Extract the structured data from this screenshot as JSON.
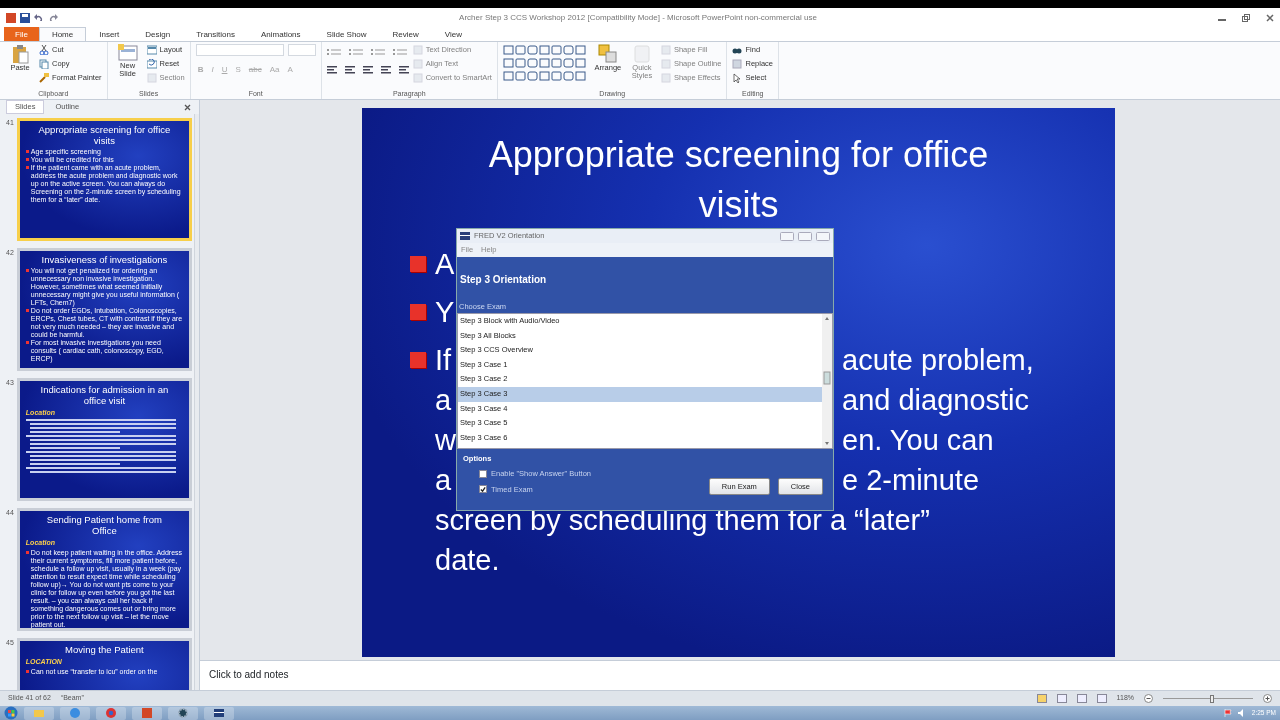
{
  "window": {
    "title": "Archer Step 3 CCS Workshop 2012 [Compatibility Mode] - Microsoft PowerPoint non-commercial use"
  },
  "ribbon_tabs": [
    {
      "label": "File",
      "kind": "file",
      "selected": false
    },
    {
      "label": "Home",
      "kind": "tab",
      "selected": true
    },
    {
      "label": "Insert",
      "kind": "tab",
      "selected": false
    },
    {
      "label": "Design",
      "kind": "tab",
      "selected": false
    },
    {
      "label": "Transitions",
      "kind": "tab",
      "selected": false
    },
    {
      "label": "Animations",
      "kind": "tab",
      "selected": false
    },
    {
      "label": "Slide Show",
      "kind": "tab",
      "selected": false
    },
    {
      "label": "Review",
      "kind": "tab",
      "selected": false
    },
    {
      "label": "View",
      "kind": "tab",
      "selected": false
    }
  ],
  "ribbon_groups": [
    {
      "label": "Clipboard",
      "items": [
        {
          "kind": "large",
          "label": "Paste",
          "disabled": false
        },
        {
          "kind": "small",
          "label": "Cut",
          "disabled": false
        },
        {
          "kind": "small",
          "label": "Copy",
          "disabled": false
        },
        {
          "kind": "small",
          "label": "Format Painter",
          "disabled": false
        }
      ]
    },
    {
      "label": "Slides",
      "items": [
        {
          "kind": "large",
          "label": "New Slide",
          "disabled": false
        },
        {
          "kind": "small",
          "label": "Layout",
          "disabled": false
        },
        {
          "kind": "small",
          "label": "Reset",
          "disabled": false
        },
        {
          "kind": "small",
          "label": "Section",
          "disabled": true
        }
      ]
    },
    {
      "label": "Font",
      "items": [
        {
          "kind": "font",
          "labels": [
            "B",
            "I",
            "U",
            "S",
            "abc",
            "Aa",
            "A"
          ],
          "disabled": true
        }
      ]
    },
    {
      "label": "Paragraph",
      "items": [
        {
          "kind": "para",
          "disabled": true
        },
        {
          "kind": "small",
          "label": "Text Direction",
          "disabled": true
        },
        {
          "kind": "small",
          "label": "Align Text",
          "disabled": true
        },
        {
          "kind": "small",
          "label": "Convert to SmartArt",
          "disabled": true
        }
      ]
    },
    {
      "label": "Drawing",
      "items": [
        {
          "kind": "shapes",
          "disabled": false
        },
        {
          "kind": "large",
          "label": "Arrange",
          "disabled": false
        },
        {
          "kind": "large",
          "label": "Quick Styles",
          "disabled": true
        },
        {
          "kind": "small",
          "label": "Shape Fill",
          "disabled": true
        },
        {
          "kind": "small",
          "label": "Shape Outline",
          "disabled": true
        },
        {
          "kind": "small",
          "label": "Shape Effects",
          "disabled": true
        }
      ]
    },
    {
      "label": "Editing",
      "items": [
        {
          "kind": "small",
          "label": "Find",
          "disabled": false
        },
        {
          "kind": "small",
          "label": "Replace",
          "disabled": false
        },
        {
          "kind": "small",
          "label": "Select",
          "disabled": false
        }
      ]
    }
  ],
  "pane_tabs": [
    {
      "label": "Slides",
      "selected": true
    },
    {
      "label": "Outline",
      "selected": false
    }
  ],
  "thumbnails": [
    {
      "number": "41",
      "selected": true,
      "title": "Appropriate  screening for office visits",
      "bullets": [
        "Age specific screening",
        "You will be credited for this",
        "If the patient came with an acute problem, address the acute problem and diagnostic work up on the active screen. You can always do Screening on the 2-minute screen by scheduling them for a “later” date."
      ]
    },
    {
      "number": "42",
      "selected": false,
      "title": "Invasiveness of investigations",
      "bullets": [
        "You will not get penalized for ordering an unnecessary non invasive investigation. However, sometimes what seemed initially unnecessary might give you useful information ( LFTs, Chem7)",
        "Do not order EGDs, Intubation, Colonoscopies, ERCPs, Chest tubes, CT with contrast if they are not very much needed – they are invasive and could be harmful.",
        "For most invasive investigations you need consults ( cardiac cath, colonoscopy, EGD, ERCP)"
      ]
    },
    {
      "number": "43",
      "selected": false,
      "title": "Indications for admission in an office visit",
      "subtitle": "Location",
      "illegible": true
    },
    {
      "number": "44",
      "selected": false,
      "title": "Sending Patient home from Office",
      "subtitle": "Location",
      "bullets": [
        "Do not keep patient waiting in the office. Address their current symptoms, fill more patient before, schedule a follow up visit, usually in a week (pay attention to result expect time while scheduling follow up)→ You do not want pts come to your clinic for follow up even before you got the last result. – you can always call her back if something dangerous comes out or bring more prior to the next follow up visit – let the move patient out."
      ]
    },
    {
      "number": "45",
      "selected": false,
      "title": "Moving the Patient",
      "subtitle": "LOCATION",
      "bullets": [
        "Can not use “transfer to icu” order on the"
      ]
    }
  ],
  "slide": {
    "title": "Appropriate screening for office visits",
    "bullets": [
      {
        "lines": [
          {
            "left": "A"
          }
        ]
      },
      {
        "lines": [
          {
            "left": "Y"
          }
        ]
      },
      {
        "lines": [
          {
            "left": "If",
            "right": "acute problem,"
          },
          {
            "left": "a",
            "right": "and diagnostic"
          },
          {
            "left": "w",
            "right": "en. You can"
          },
          {
            "left": "a",
            "right": "e 2-minute"
          },
          {
            "left": "screen by scheduling them for a “later”"
          },
          {
            "left": "date."
          }
        ]
      }
    ]
  },
  "dialog": {
    "title": "FRED V2 Orientation",
    "menu": [
      "File",
      "Help"
    ],
    "heading": "Step 3 Orientation",
    "list_label": "Choose Exam",
    "exams": [
      {
        "label": "Step 3 Block with Audio/Video",
        "selected": false
      },
      {
        "label": "Step 3 All Blocks",
        "selected": false
      },
      {
        "label": "Step 3 CCS Overview",
        "selected": false
      },
      {
        "label": "Step 3 Case 1",
        "selected": false
      },
      {
        "label": "Step 3 Case 2",
        "selected": false
      },
      {
        "label": "Step 3 Case 3",
        "selected": true
      },
      {
        "label": "Step 3 Case 4",
        "selected": false
      },
      {
        "label": "Step 3 Case 5",
        "selected": false
      },
      {
        "label": "Step 3 Case 6",
        "selected": false
      }
    ],
    "options_label": "Options",
    "options": [
      {
        "label": "Enable \"Show Answer\" Button",
        "checked": false
      },
      {
        "label": "Timed Exam",
        "checked": true
      }
    ],
    "buttons": [
      "Run Exam",
      "Close"
    ]
  },
  "notes": {
    "placeholder": "Click to add notes"
  },
  "status_bar": {
    "slide": "Slide 41 of 62",
    "theme": "“Beam”",
    "zoom": "118%",
    "zoom_slider": {
      "level": 0.55
    }
  },
  "taskbar": {
    "clock": "2:25 PM"
  }
}
